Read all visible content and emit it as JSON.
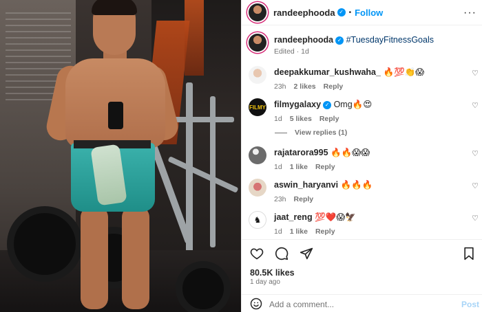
{
  "post": {
    "author": "randeephooda",
    "follow_label": "Follow",
    "dot": "•",
    "more_icon": "more-options-icon",
    "caption": {
      "user": "randeephooda",
      "text": "#TuesdayFitnessGoals",
      "meta": "Edited · 1d"
    }
  },
  "comments": [
    {
      "user": "deepakkumar_kushwaha_",
      "text": "🔥💯👏😱",
      "time": "23h",
      "likes": "2 likes",
      "reply": "Reply",
      "avatar": "user-avatar-photo"
    },
    {
      "user": "filmygalaxy",
      "verified": true,
      "text": "Omg🔥😍",
      "time": "1d",
      "likes": "5 likes",
      "reply": "Reply",
      "avatar": "filmygalaxy-logo",
      "avatar_text": "FILMY"
    },
    {
      "user": "rajatarora995",
      "text": "🔥🔥😱😱",
      "time": "1d",
      "likes": "1 like",
      "reply": "Reply",
      "avatar": "user-avatar-photo"
    },
    {
      "user": "aswin_haryanvi",
      "text": "🔥🔥🔥",
      "time": "23h",
      "likes": "",
      "reply": "Reply",
      "avatar": "user-avatar-photo"
    },
    {
      "user": "jaat_reng",
      "text": "💯❤️😱🦅",
      "time": "1d",
      "likes": "1 like",
      "reply": "Reply",
      "avatar": "user-avatar-logo",
      "avatar_text": "♞"
    }
  ],
  "view_replies": "View replies (1)",
  "stats": {
    "likes": "80.5K likes",
    "time_ago": "1 day ago"
  },
  "add_comment": {
    "placeholder": "Add a comment...",
    "post_label": "Post"
  },
  "colors": {
    "link_blue": "#0095f6",
    "hashtag": "#00376b",
    "meta_gray": "#737373",
    "ring": "#d62976"
  }
}
